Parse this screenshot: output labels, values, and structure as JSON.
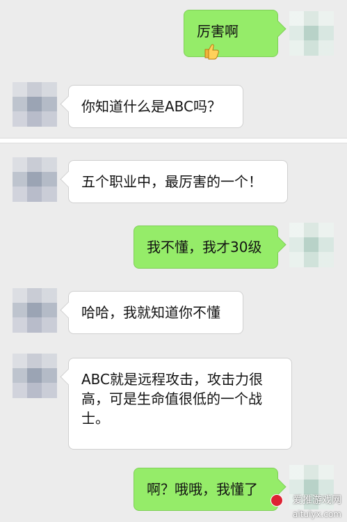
{
  "messages": [
    {
      "side": "right",
      "text": "厉害啊"
    },
    {
      "side": "left",
      "text": "你知道什么是ABC吗？"
    },
    {
      "side": "left",
      "text": "五个职业中，最厉害的一个！"
    },
    {
      "side": "right",
      "text": "我不懂，我才30级"
    },
    {
      "side": "left",
      "text": "哈哈，我就知道你不懂"
    },
    {
      "side": "left",
      "text": "ABC就是远程攻击，攻击力很高，可是生命值很低的一个战士。"
    },
    {
      "side": "right",
      "text": "啊？哦哦，我懂了"
    }
  ],
  "emoji": {
    "thumbs_up": "thumbs-up-icon"
  },
  "watermark": {
    "site_name": "爱推游戏网",
    "site_url": "aituiyx.com"
  },
  "colors": {
    "background": "#ececec",
    "left_bubble": "#ffffff",
    "right_bubble": "#95ec69"
  }
}
